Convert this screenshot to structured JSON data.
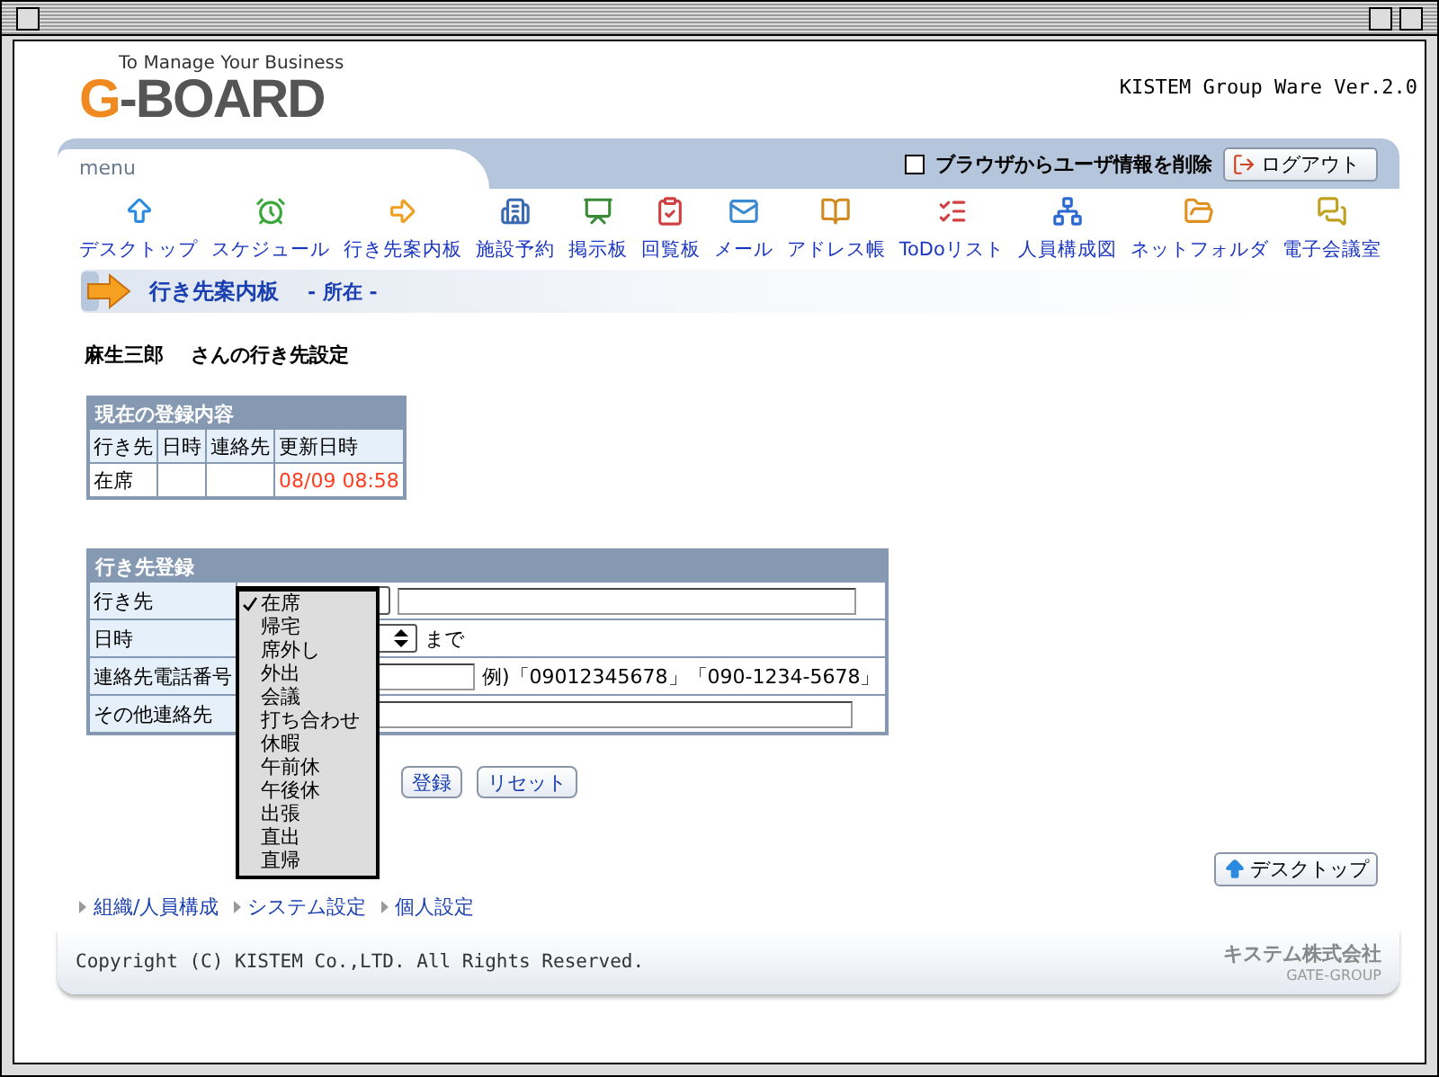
{
  "header": {
    "tagline": "To Manage Your Business",
    "logo": "G-BOARD",
    "product": "KISTEM Group Ware Ver.2.0"
  },
  "menu": {
    "tab": "menu",
    "clear_info": {
      "label": "ブラウザからユーザ情報を削除",
      "checked": false
    },
    "logout": "ログアウト",
    "items": [
      {
        "label": "デスクトップ"
      },
      {
        "label": "スケジュール"
      },
      {
        "label": "行き先案内板"
      },
      {
        "label": "施設予約"
      },
      {
        "label": "掲示板"
      },
      {
        "label": "回覧板"
      },
      {
        "label": "メール"
      },
      {
        "label": "アドレス帳"
      },
      {
        "label": "ToDoリスト"
      },
      {
        "label": "人員構成図"
      },
      {
        "label": "ネットフォルダ"
      },
      {
        "label": "電子会議室"
      }
    ]
  },
  "section": {
    "title": "行き先案内板",
    "subtitle": "- 所在 -"
  },
  "user_heading": "麻生三郎　 さんの行き先設定",
  "current": {
    "title": "現在の登録内容",
    "columns": [
      "行き先",
      "日時",
      "連絡先",
      "更新日時"
    ],
    "row": {
      "destination": "在席",
      "updated": "08/09 08:58"
    }
  },
  "register": {
    "title": "行き先登録",
    "rows": [
      {
        "label": "行き先",
        "kind": "destination"
      },
      {
        "label": "日時",
        "kind": "datetime",
        "suffix": "まで"
      },
      {
        "label": "連絡先電話番号",
        "kind": "phone",
        "hint": "例)「09012345678」「090-1234-5678」"
      },
      {
        "label": "その他連絡先",
        "kind": "text"
      }
    ],
    "options": [
      {
        "label": "在席",
        "selected": true
      },
      {
        "label": "帰宅",
        "selected": false
      },
      {
        "label": "席外し",
        "selected": false
      },
      {
        "label": "外出",
        "selected": false
      },
      {
        "label": "会議",
        "selected": false
      },
      {
        "label": "打ち合わせ",
        "selected": false
      },
      {
        "label": "休暇",
        "selected": false
      },
      {
        "label": "午前休",
        "selected": false
      },
      {
        "label": "午後休",
        "selected": false
      },
      {
        "label": "出張",
        "selected": false
      },
      {
        "label": "直出",
        "selected": false
      },
      {
        "label": "直帰",
        "selected": false
      }
    ],
    "buttons": [
      "登録",
      "リセット"
    ]
  },
  "desktop_button": "デスクトップ",
  "footer_links": [
    "組織/人員構成",
    "システム設定",
    "個人設定"
  ],
  "copyright": "Copyright (C) KISTEM Co.,LTD. All Rights Reserved.",
  "company": {
    "name": "キステム株式会社",
    "group": "GATE-GROUP"
  }
}
